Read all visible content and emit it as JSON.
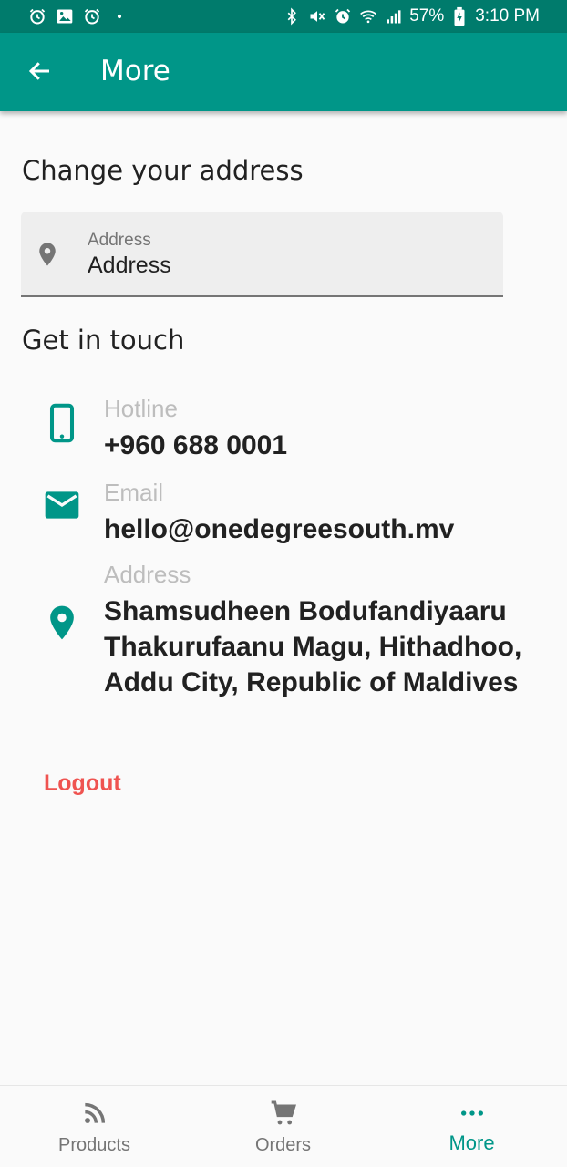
{
  "status_bar": {
    "battery": "57%",
    "time": "3:10 PM",
    "left_icons": [
      "alarm-icon",
      "image-icon",
      "alarm-icon",
      "dot-icon"
    ],
    "right_icons": [
      "bluetooth-icon",
      "mute-icon",
      "alarm-icon",
      "wifi-icon",
      "signal-icon",
      "battery-icon"
    ]
  },
  "app_bar": {
    "title": "More",
    "back_icon": "arrow-left-icon",
    "color": "#009688"
  },
  "change_address": {
    "title": "Change your address",
    "field_label": "Address",
    "field_value": "Address",
    "icon": "location-pin-icon"
  },
  "get_in_touch": {
    "title": "Get in touch",
    "hotline_label": "Hotline",
    "hotline_value": "+960 688 0001",
    "email_label": "Email",
    "email_value": "hello@onedegreesouth.mv",
    "address_label": "Address",
    "address_lines": [
      "Shamsudheen Bodufandiyaaru",
      "Thakurufaanu Magu, Hithadhoo,",
      "Addu City, Republic of Maldives"
    ]
  },
  "logout_label": "Logout",
  "bottom_nav": {
    "items": [
      {
        "label": "Products",
        "icon": "rss-feed-icon",
        "active": false
      },
      {
        "label": "Orders",
        "icon": "cart-icon",
        "active": false
      },
      {
        "label": "More",
        "icon": "more-horizontal-icon",
        "active": true
      }
    ]
  },
  "colors": {
    "primary": "#009688",
    "status_bar": "#007b6c",
    "logout": "#ef5350"
  }
}
